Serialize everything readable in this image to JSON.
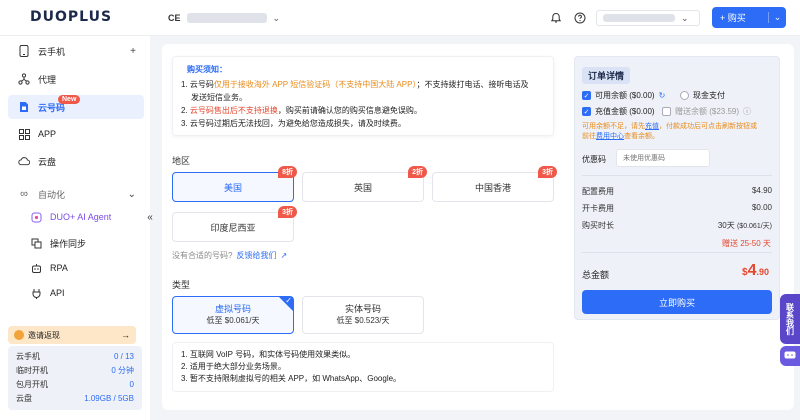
{
  "header": {
    "logo": "DUOPLUS",
    "workspace_code": "CE",
    "buy_label": "+ 购买",
    "buy_arrow": "⌄"
  },
  "sidebar": {
    "items": [
      {
        "label": "云手机",
        "tail": "+"
      },
      {
        "label": "代理"
      },
      {
        "label": "云号码",
        "badge": "New"
      },
      {
        "label": "APP"
      },
      {
        "label": "云盘"
      },
      {
        "label": "自动化",
        "tail": "⌄"
      },
      {
        "label": "DUO+ AI Agent"
      },
      {
        "label": "操作同步"
      },
      {
        "label": "RPA"
      },
      {
        "label": "API"
      }
    ],
    "invite": "邀请返现",
    "stats": [
      {
        "label": "云手机",
        "value": "0 / 13"
      },
      {
        "label": "临时开机",
        "value": "0 分钟"
      },
      {
        "label": "包月开机",
        "value": "0"
      },
      {
        "label": "云盘",
        "value": "1.09GB / 5GB"
      }
    ]
  },
  "notice": {
    "title": "购买须知：",
    "line1_a": "1. 云号码",
    "line1_b": "仅用于接收海外 APP 短信验证码（不支持中国大陆 APP）",
    "line1_c": "；不支持拨打电话、接听电话及",
    "line1_d": "发送短信业务。",
    "line2_a": "2. ",
    "line2_b": "云号码售出后不支持退换",
    "line2_c": "，购买前请确认您的购买信息避免误购。",
    "line3": "3. 云号码过期后无法找回，为避免给您造成损失，请及时续费。"
  },
  "region": {
    "label": "地区",
    "options": [
      {
        "name": "美国",
        "discount": "8折"
      },
      {
        "name": "英国",
        "discount": "2折"
      },
      {
        "name": "中国香港",
        "discount": "3折"
      },
      {
        "name": "印度尼西亚",
        "discount": "3折"
      }
    ],
    "feedback_q": "没有合适的号码?",
    "feedback_link": "反馈给我们"
  },
  "type": {
    "label": "类型",
    "options": [
      {
        "name": "虚拟号码",
        "price": "低至 $0.061/天"
      },
      {
        "name": "实体号码",
        "price": "低至 $0.523/天"
      }
    ],
    "info": [
      "1. 互联网 VoIP 号码，和实体号码使用效果类似。",
      "2. 适用于绝大部分业务场景。",
      "3. 暂不支持限制虚拟号的相关 APP，如 WhatsApp、Google。"
    ]
  },
  "order": {
    "title": "订单详情",
    "balance": "可用余额 ($0.00)",
    "cash": "现金支付",
    "recharge": "充值金额 ($0.00)",
    "gift": "赠送余额 ($23.59)",
    "warn_a": "可用余额不足，请先",
    "warn_link": "充值",
    "warn_b": "，付款成功后可点击刷新按钮或",
    "warn_c": "前往",
    "warn_link2": "费用中心",
    "warn_d": "查看余额。",
    "coupon_label": "优惠码",
    "coupon_placeholder": "未使用优惠码",
    "rows": [
      {
        "label": "配置费用",
        "value": "$4.90"
      },
      {
        "label": "开卡费用",
        "value": "$0.00"
      },
      {
        "label": "购买时长",
        "value": "30天",
        "sub": "($0.061/天)"
      }
    ],
    "gift_days": "赠送 25-50 天",
    "total_label": "总金额",
    "total_cur": "$",
    "total_int": "4",
    "total_dec": ".90",
    "buy_now": "立即购买"
  },
  "contact": "联系我们"
}
